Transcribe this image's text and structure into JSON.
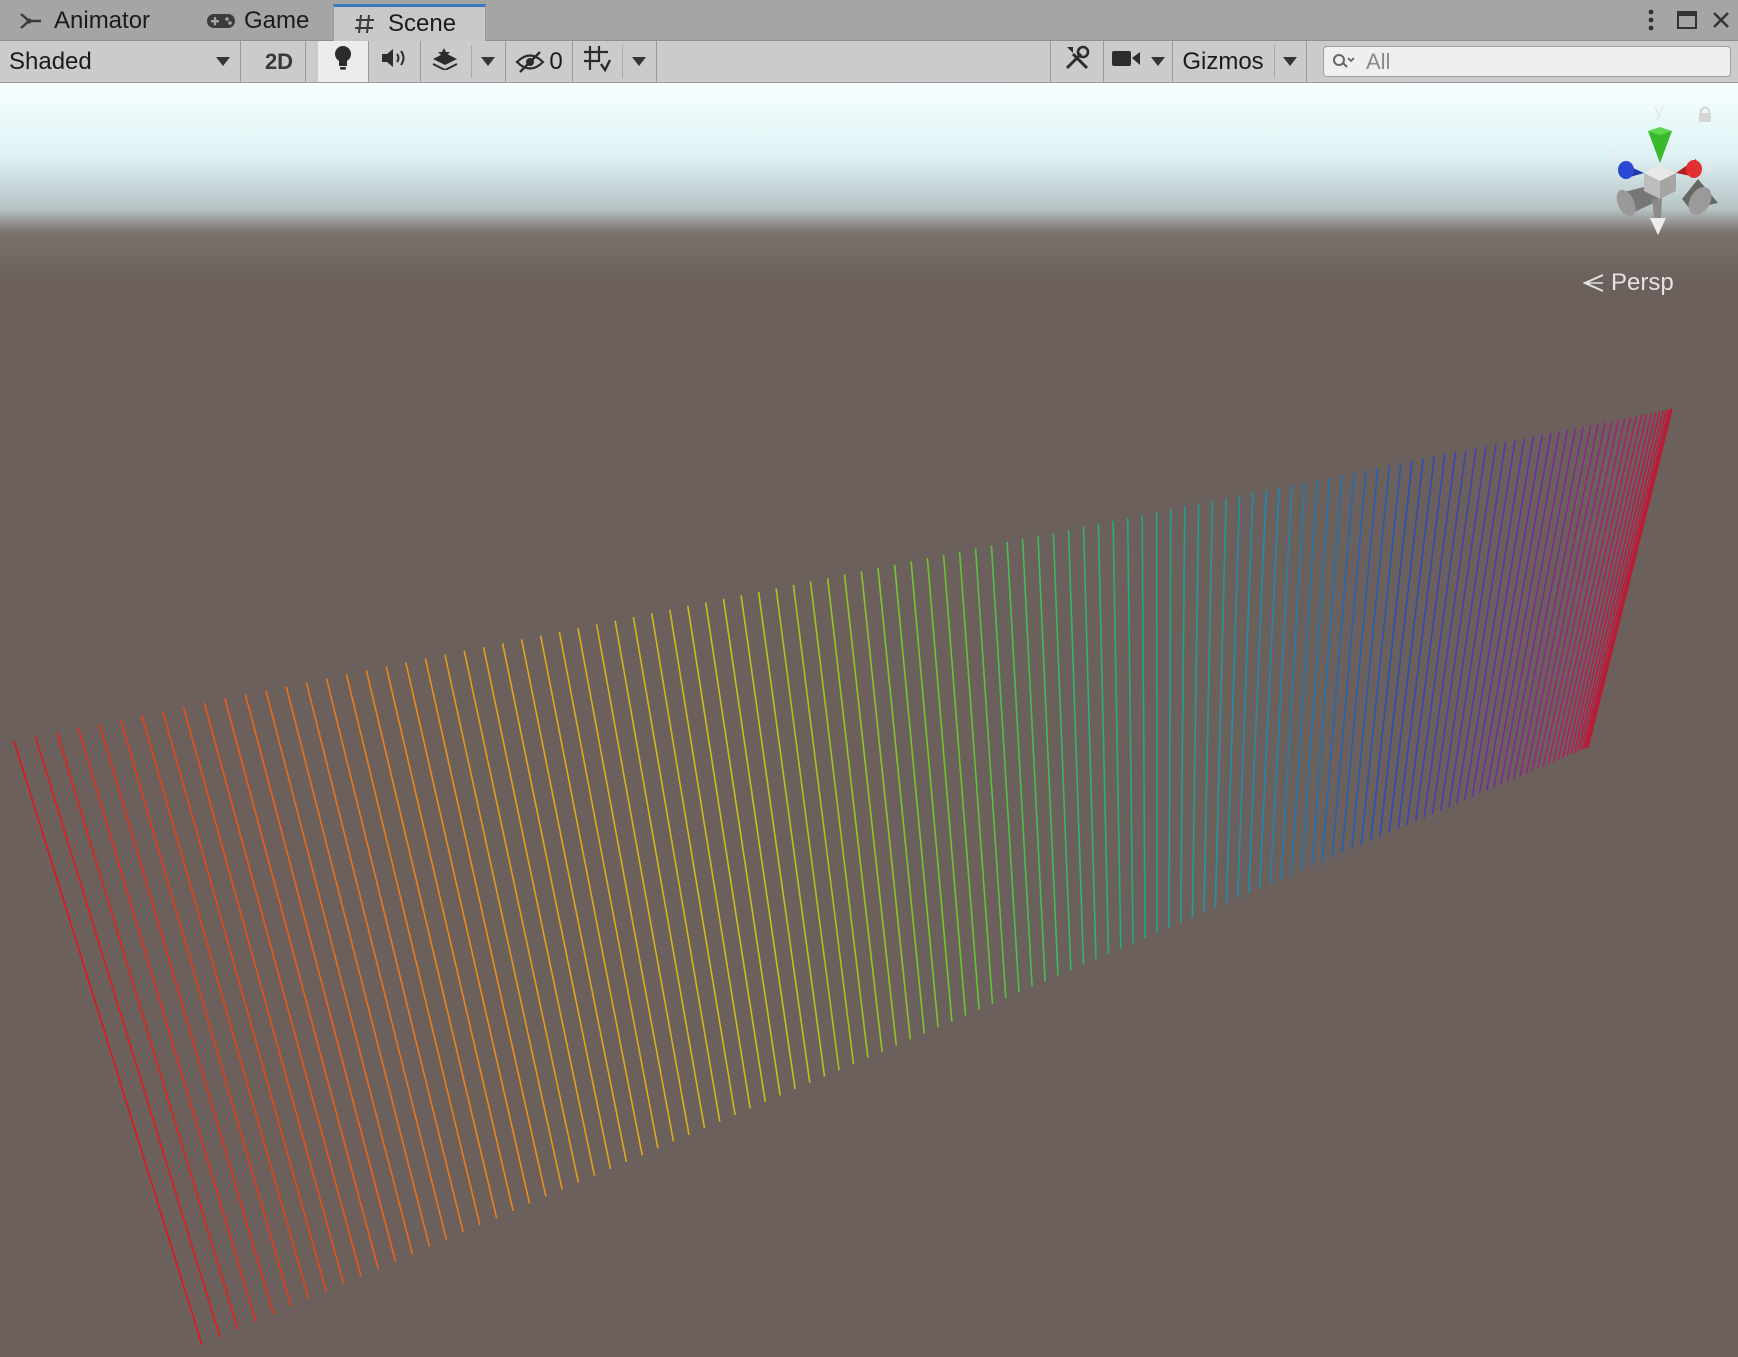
{
  "tabs": [
    {
      "label": "Animator",
      "icon": "animator-icon"
    },
    {
      "label": "Game",
      "icon": "gamepad-icon"
    },
    {
      "label": "Scene",
      "icon": "grid-hash-icon",
      "active": true
    }
  ],
  "window_controls": [
    "kebab-menu-icon",
    "maximize-icon",
    "close-icon"
  ],
  "toolbar": {
    "draw_mode": "Shaded",
    "mode_2d": "2D",
    "lighting_icon": "lightbulb-icon",
    "audio_icon": "speaker-icon",
    "effects_icon": "effects-layers-icon",
    "hidden_count": "0",
    "hidden_icon": "eye-slash-icon",
    "grid_icon": "grid-snap-icon",
    "tools_icon": "tools-icon",
    "camera_icon": "camera-icon",
    "gizmos_label": "Gizmos",
    "search_placeholder": "All"
  },
  "scene": {
    "gizmo_axes": {
      "x": "x",
      "y": "y",
      "z": "z"
    },
    "projection_label": "Persp",
    "line_count": 120,
    "line_gradient_colors": [
      "#e0161c",
      "#ee6a18",
      "#e3a41a",
      "#c3c21c",
      "#6ec72a",
      "#25b07a",
      "#1f8bab",
      "#2550b8",
      "#6a2ea8",
      "#a42470",
      "#c01830"
    ]
  },
  "colors": {
    "active_tab_accent": "#3a79bb",
    "tabbar_bg": "#a5a5a5",
    "toolbar_bg": "#cbcbcb",
    "ground": "#6b605b",
    "gizmo_x": "#d42a2a",
    "gizmo_y": "#36b82a",
    "gizmo_z": "#2a48d4"
  }
}
